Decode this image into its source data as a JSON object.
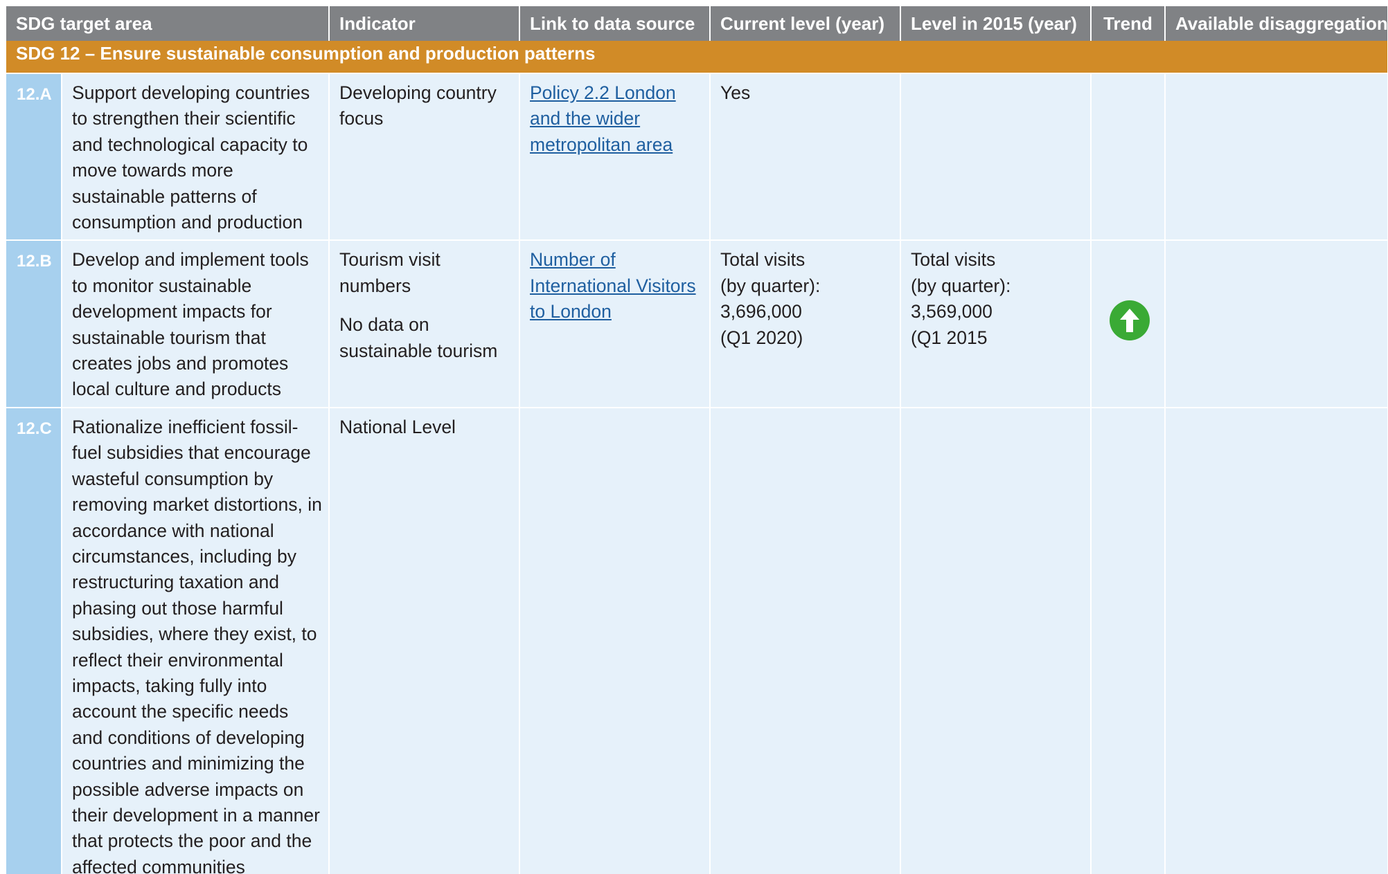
{
  "table": {
    "headers": {
      "target_area": "SDG target area",
      "indicator": "Indicator",
      "link": "Link to data source",
      "current": "Current level (year)",
      "level_2015": "Level in 2015 (year)",
      "trend": "Trend",
      "disaggregation": "Available disaggregation"
    },
    "section": "SDG 12 – Ensure sustainable consumption and production patterns",
    "rows": [
      {
        "code": "12.A",
        "target": "Support developing countries to strengthen their scientific and technological capacity to move towards more sustainable patterns of consumption and production",
        "indicator": [
          "Developing country focus"
        ],
        "link": "Policy 2.2 London and the wider metropolitan area",
        "current": [
          "Yes"
        ],
        "level_2015": [],
        "trend": "",
        "disaggregation": ""
      },
      {
        "code": "12.B",
        "target": "Develop and implement tools to monitor sustainable development impacts for sustainable tourism that creates jobs and promotes local culture and products",
        "indicator": [
          "Tourism visit numbers",
          "No data on sustainable tourism"
        ],
        "link": "Number of International Visitors to London",
        "current": [
          "Total visits",
          "(by quarter):",
          "3,696,000",
          "(Q1 2020)"
        ],
        "level_2015": [
          "Total visits",
          "(by quarter):",
          "3,569,000",
          "(Q1 2015"
        ],
        "trend": "up-arrow-icon",
        "disaggregation": ""
      },
      {
        "code": "12.C",
        "target": "Rationalize inefficient fossil-fuel subsidies that encourage wasteful consumption by removing market distortions, in accordance with national circumstances, including by restructuring taxation and phasing out those harmful subsidies, where they exist, to reflect their environmental impacts, taking fully into account the specific needs and conditions of developing countries and minimizing the possible adverse impacts on their development in a manner that protects the poor and the affected communities",
        "indicator": [
          "National Level"
        ],
        "link": "",
        "current": [],
        "level_2015": [],
        "trend": "",
        "disaggregation": ""
      }
    ]
  },
  "colors": {
    "header_bg": "#808285",
    "section_bg": "#d18b27",
    "code_bg": "#a7d0ee",
    "cell_bg": "#e6f1fa",
    "link": "#1f5fa0",
    "trend_up": "#3aaa35"
  }
}
